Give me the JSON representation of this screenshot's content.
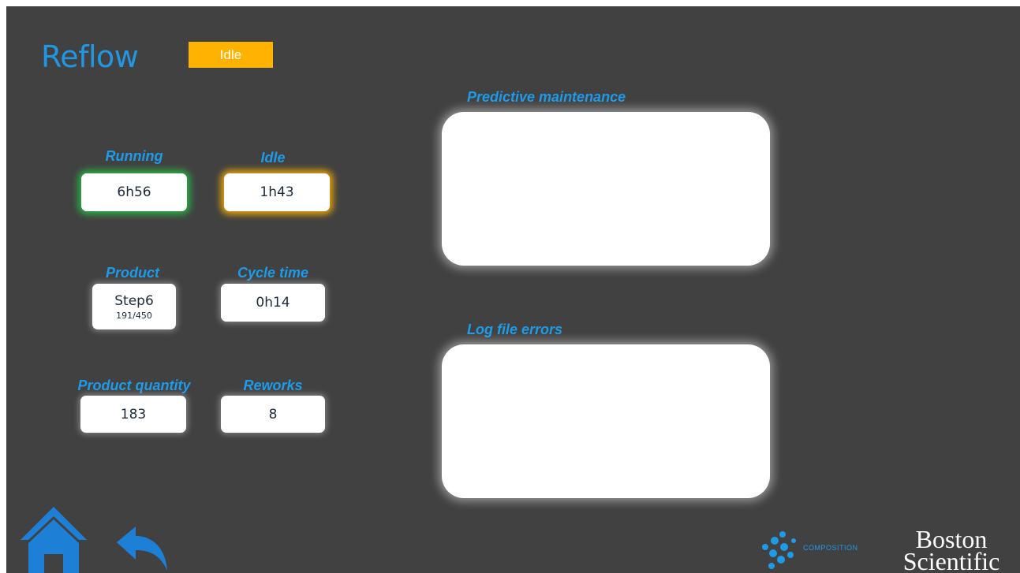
{
  "header": {
    "title": "Reflow",
    "status": "Idle",
    "status_color": "#ffb300",
    "accent_color": "#1e9be8"
  },
  "metrics": {
    "running": {
      "label": "Running",
      "value": "6h56"
    },
    "idle": {
      "label": "Idle",
      "value": "1h43"
    },
    "product": {
      "label": "Product",
      "value": "Step6",
      "sub": "191/450"
    },
    "cycle_time": {
      "label": "Cycle time",
      "value": "0h14"
    },
    "product_quantity": {
      "label": "Product quantity",
      "value": "183"
    },
    "reworks": {
      "label": "Reworks",
      "value": "8"
    }
  },
  "panels": {
    "predictive_maintenance": {
      "label": "Predictive maintenance"
    },
    "log_file_errors": {
      "label": "Log file errors"
    }
  },
  "footer": {
    "home_icon": "home-icon",
    "back_icon": "back-arrow-icon",
    "composition_text": "COMPOSITION",
    "brand_line1": "Boston",
    "brand_line2": "Scientific"
  }
}
